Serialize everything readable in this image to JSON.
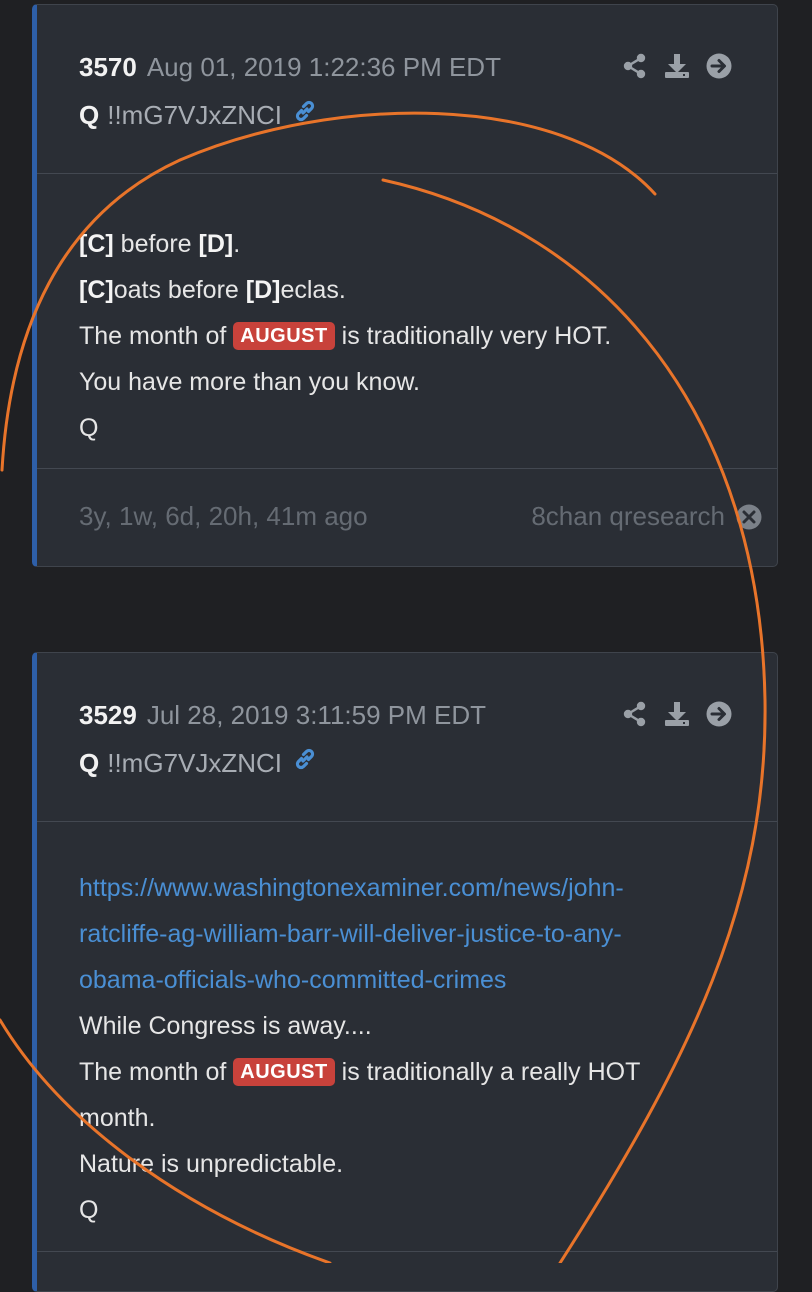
{
  "posts": [
    {
      "number": "3570",
      "date": "Aug 01, 2019 1:22:36 PM EDT",
      "author": "Q",
      "tripcode": "!!mG7VJxZNCI",
      "lines": {
        "l1_a": "[C]",
        "l1_b": " before ",
        "l1_c": "[D]",
        "l1_d": ".",
        "l2_a": "[C]",
        "l2_b": "oats before ",
        "l2_c": "[D]",
        "l2_d": "eclas.",
        "l3_a": "The month of ",
        "l3_tag": "AUGUST",
        "l3_b": " is traditionally very HOT.",
        "l4": "You have more than you know.",
        "l5": "Q"
      },
      "ago": "3y, 1w, 6d, 20h, 41m ago",
      "source": "8chan qresearch"
    },
    {
      "number": "3529",
      "date": "Jul 28, 2019 3:11:59 PM EDT",
      "author": "Q",
      "tripcode": "!!mG7VJxZNCI",
      "url_lines": [
        "https://www.washingtonexaminer.com/news/john-",
        "ratcliffe-ag-william-barr-will-deliver-justice-to-any-",
        "obama-officials-who-committed-crimes"
      ],
      "lines": {
        "l1": "While Congress is away....",
        "l2_a": "The month of ",
        "l2_tag": "AUGUST",
        "l2_b": " is traditionally a really HOT",
        "l3": "month.",
        "l4": "Nature is unpredictable.",
        "l5": "Q"
      }
    }
  ],
  "icons": [
    "share-icon",
    "download-icon",
    "arrow-right-circle-icon",
    "link-icon",
    "close-circle-icon"
  ],
  "colors": {
    "accent_bar": "#2e5fa8",
    "tag_red": "#c8423b",
    "link_blue": "#4a8fd4",
    "annotation_orange": "#e8742a"
  }
}
